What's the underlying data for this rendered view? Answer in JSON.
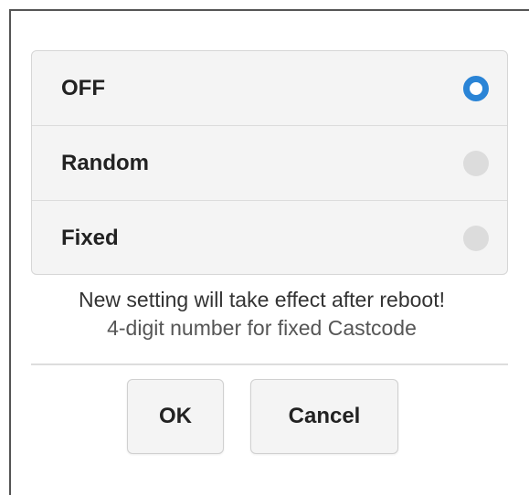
{
  "options": [
    {
      "label": "OFF",
      "selected": true
    },
    {
      "label": "Random",
      "selected": false
    },
    {
      "label": "Fixed",
      "selected": false
    }
  ],
  "notice": {
    "line1": "New setting will take effect after reboot!",
    "line2": "4-digit number for fixed Castcode"
  },
  "buttons": {
    "ok": "OK",
    "cancel": "Cancel"
  },
  "colors": {
    "accent": "#2a84d6",
    "radio_off": "#dcdcdc"
  }
}
